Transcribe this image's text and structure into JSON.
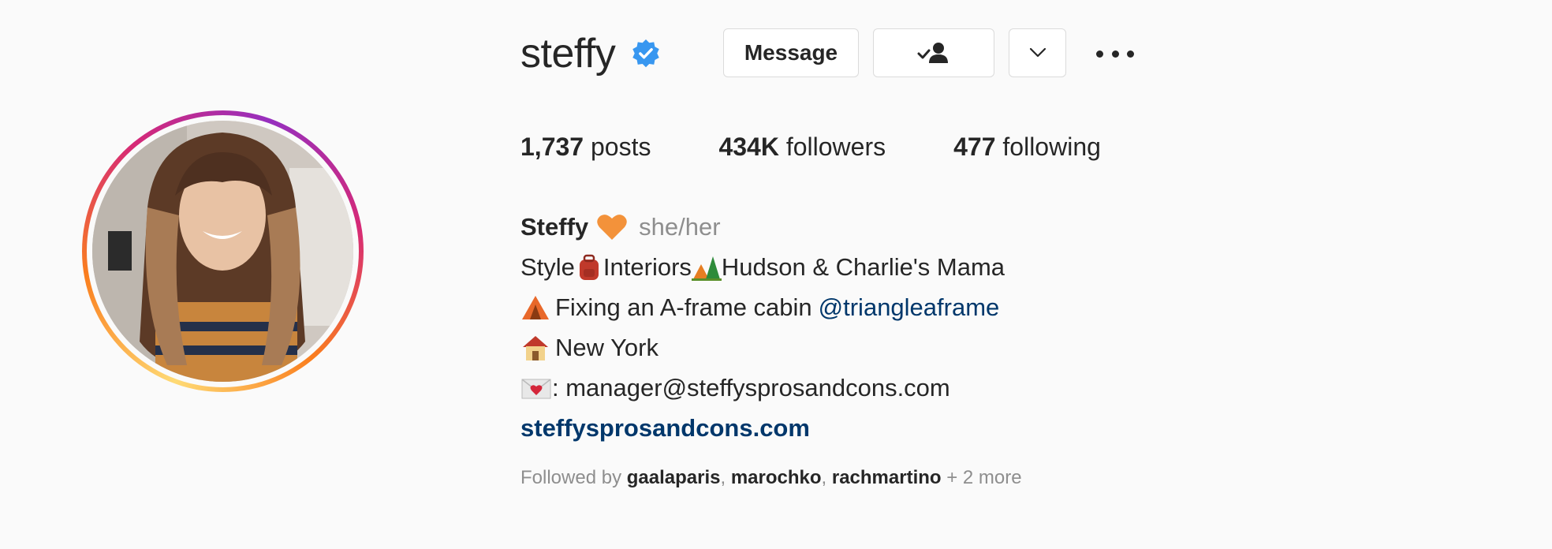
{
  "profile": {
    "username": "steffy",
    "verified": true,
    "buttons": {
      "message_label": "Message"
    },
    "icons": {
      "verified": "verified-badge-icon",
      "following": "following-check-person-icon",
      "chevron": "chevron-down-icon",
      "more": "more-options-icon"
    },
    "stats": {
      "posts_value": "1,737",
      "posts_label": "posts",
      "followers_value": "434K",
      "followers_label": "followers",
      "following_value": "477",
      "following_label": "following"
    },
    "bio": {
      "name": "Steffy",
      "pronouns": "she/her",
      "line1_a": "Style",
      "line1_b": "Interiors",
      "line1_c": "Hudson & Charlie's Mama",
      "line2_text": "Fixing an A-frame cabin",
      "line2_mention": "@triangleaframe",
      "line3_text": "New York",
      "line4_text": ": manager@steffyspros​andcons.com",
      "website": "steffysprosandcons.com"
    },
    "followed_by": {
      "prefix": "Followed by",
      "user1": "gaalaparis",
      "sep1": ",",
      "user2": "marochko",
      "sep2": ",",
      "user3": "rachmartino",
      "suffix": "+ 2 more"
    },
    "colors": {
      "verified_blue": "#3897f0",
      "link_blue": "#00376b",
      "muted_gray": "#8e8e8e"
    }
  }
}
